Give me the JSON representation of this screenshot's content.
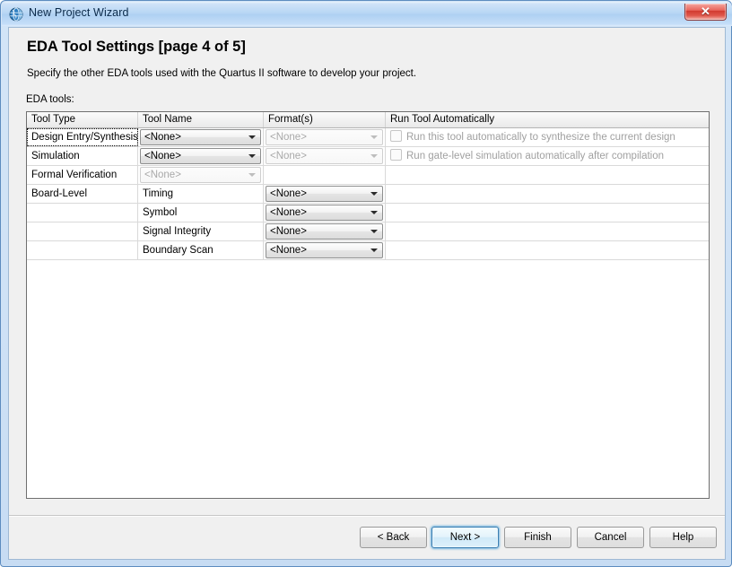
{
  "window": {
    "title": "New Project Wizard",
    "icon": "quartus-globe-icon",
    "close_label": "✕"
  },
  "page": {
    "title": "EDA Tool Settings [page 4 of 5]",
    "description": "Specify the other EDA tools used with the Quartus II software to develop your project.",
    "section_label": "EDA tools:"
  },
  "table": {
    "columns": [
      "Tool Type",
      "Tool Name",
      "Format(s)",
      "Run Tool Automatically"
    ],
    "rows": [
      {
        "tool_type": "Design Entry/Synthesis",
        "tool_type_focused": true,
        "tool_name": {
          "kind": "combo",
          "value": "<None>",
          "disabled": false
        },
        "format": {
          "kind": "combo",
          "value": "<None>",
          "disabled": true
        },
        "run_auto": {
          "kind": "checkbox",
          "label": "Run this tool automatically to synthesize the current design",
          "checked": false,
          "disabled": true
        }
      },
      {
        "tool_type": "Simulation",
        "tool_type_focused": false,
        "tool_name": {
          "kind": "combo",
          "value": "<None>",
          "disabled": false
        },
        "format": {
          "kind": "combo",
          "value": "<None>",
          "disabled": true
        },
        "run_auto": {
          "kind": "checkbox",
          "label": "Run gate-level simulation automatically after compilation",
          "checked": false,
          "disabled": true
        }
      },
      {
        "tool_type": "Formal Verification",
        "tool_type_focused": false,
        "tool_name": {
          "kind": "combo",
          "value": "<None>",
          "disabled": true
        },
        "format": {
          "kind": "empty"
        },
        "run_auto": {
          "kind": "empty"
        }
      },
      {
        "tool_type": "Board-Level",
        "tool_type_focused": false,
        "tool_name": {
          "kind": "text",
          "value": "Timing"
        },
        "format": {
          "kind": "combo",
          "value": "<None>",
          "disabled": false
        },
        "run_auto": {
          "kind": "empty"
        }
      },
      {
        "tool_type": "",
        "tool_type_focused": false,
        "tool_name": {
          "kind": "text",
          "value": "Symbol"
        },
        "format": {
          "kind": "combo",
          "value": "<None>",
          "disabled": false
        },
        "run_auto": {
          "kind": "empty"
        }
      },
      {
        "tool_type": "",
        "tool_type_focused": false,
        "tool_name": {
          "kind": "text",
          "value": "Signal Integrity"
        },
        "format": {
          "kind": "combo",
          "value": "<None>",
          "disabled": false
        },
        "run_auto": {
          "kind": "empty"
        }
      },
      {
        "tool_type": "",
        "tool_type_focused": false,
        "tool_name": {
          "kind": "text",
          "value": "Boundary Scan"
        },
        "format": {
          "kind": "combo",
          "value": "<None>",
          "disabled": false
        },
        "run_auto": {
          "kind": "empty"
        }
      }
    ]
  },
  "footer": {
    "buttons": [
      {
        "name": "back",
        "label": "< Back",
        "default": false
      },
      {
        "name": "next",
        "label": "Next >",
        "default": true
      },
      {
        "name": "finish",
        "label": "Finish",
        "default": false
      },
      {
        "name": "cancel",
        "label": "Cancel",
        "default": false
      },
      {
        "name": "help",
        "label": "Help",
        "default": false
      }
    ]
  },
  "colors": {
    "titlebar": "#b7d6f4",
    "close_red": "#d23b30",
    "default_button_border": "#3c7fb1",
    "client_bg": "#f0f0f0",
    "disabled_text": "#a9a9a9"
  }
}
